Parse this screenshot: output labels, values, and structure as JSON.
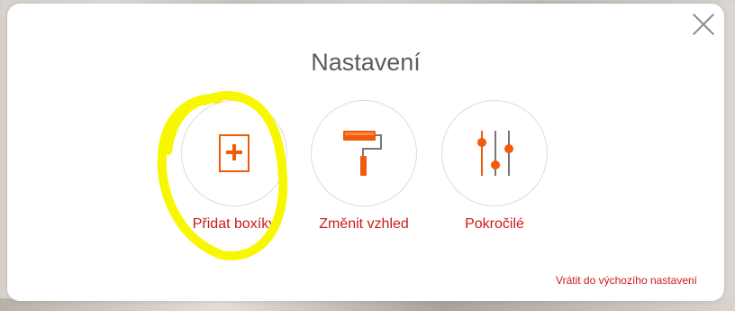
{
  "dialog": {
    "title": "Nastavení",
    "close_icon": "close-icon"
  },
  "options": [
    {
      "label": "Přidat boxíky",
      "icon": "add-box-icon"
    },
    {
      "label": "Změnit vzhled",
      "icon": "paint-roller-icon"
    },
    {
      "label": "Pokročilé",
      "icon": "sliders-icon"
    }
  ],
  "footer": {
    "reset_label": "Vrátit do výchozího nastavení"
  },
  "colors": {
    "accent": "#f05a0a",
    "link": "#cc1a1a",
    "highlight": "#f7f700"
  }
}
